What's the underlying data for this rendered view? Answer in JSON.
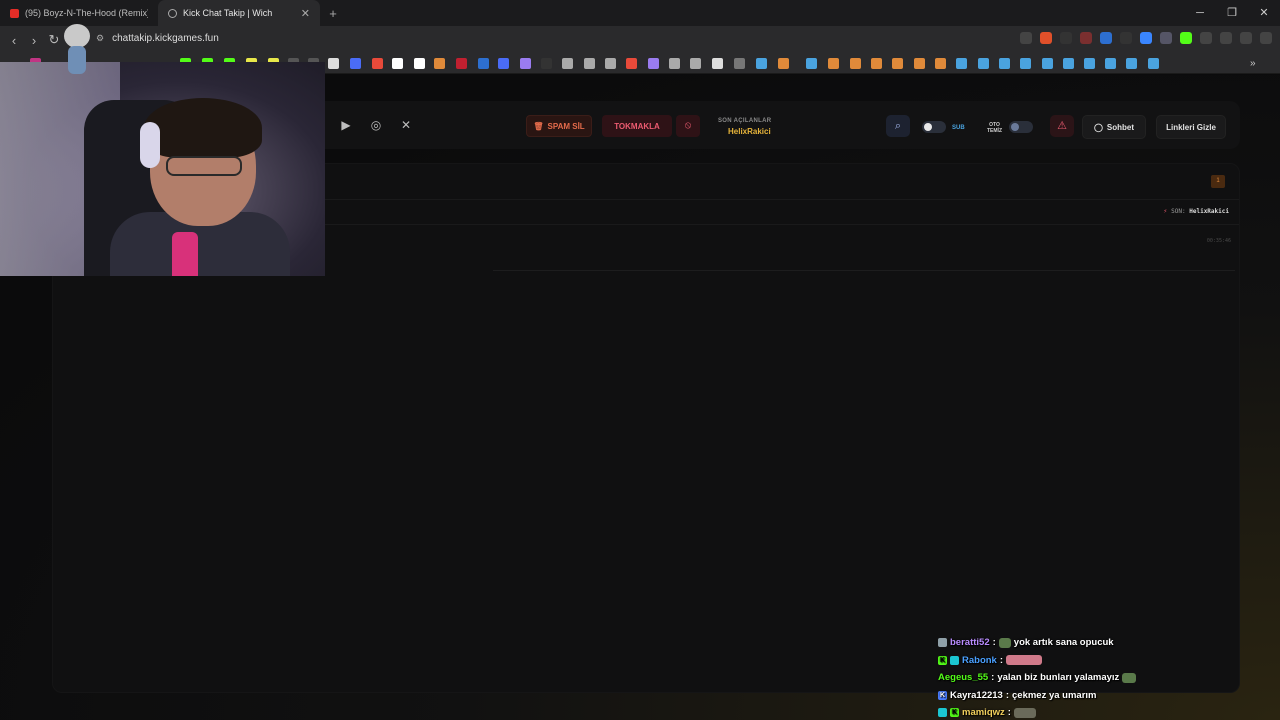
{
  "browser": {
    "tabs": [
      {
        "title": "(95) Boyz-N-The-Hood (Remix) -",
        "active": false
      },
      {
        "title": "Kick Chat Takip | Wich",
        "active": true
      }
    ],
    "url": "chattakip.kickgames.fun"
  },
  "header": {
    "spam_label": "SPAM SİL",
    "tokmakla_label": "TOKMAKLA",
    "son_acilanlar_label": "SON AÇILANLAR",
    "son_acilanlar_name": "HelixRakici",
    "sub_label": "SUB",
    "oto_temiz_label_1": "OTO",
    "oto_temiz_label_2": "TEMİZ",
    "sohbet_label": "Sohbet",
    "linkleri_gizle_label": "Linkleri Gizle"
  },
  "panel": {
    "count": "1",
    "son_label": "SON:",
    "son_name": "HelixRakici",
    "message_time": "00:35:46"
  },
  "chat": [
    {
      "user": "beratti52",
      "user_color": "#b98cff",
      "text": "yok artık sana opucuk",
      "badges": [
        "gray"
      ]
    },
    {
      "user": "Rabonk",
      "user_color": "#4aa0ff",
      "text": "",
      "badges": [
        "green",
        "teal"
      ]
    },
    {
      "user": "Aegeus_55",
      "user_color": "#53fc18",
      "text": "yalan biz bunları yalamayız",
      "badges": []
    },
    {
      "user": "Kayra12213",
      "user_color": "#ffffff",
      "text": "çekmez ya umarım",
      "badges": [
        "blue"
      ]
    },
    {
      "user": "mamiqwz",
      "user_color": "#f2d05c",
      "text": "",
      "badges": [
        "teal",
        "green"
      ]
    }
  ],
  "colors": {
    "accent_red": "#ec5b70",
    "accent_orange": "#e46b4b",
    "kick_green": "#53fc18",
    "gold": "#e7b43a"
  }
}
